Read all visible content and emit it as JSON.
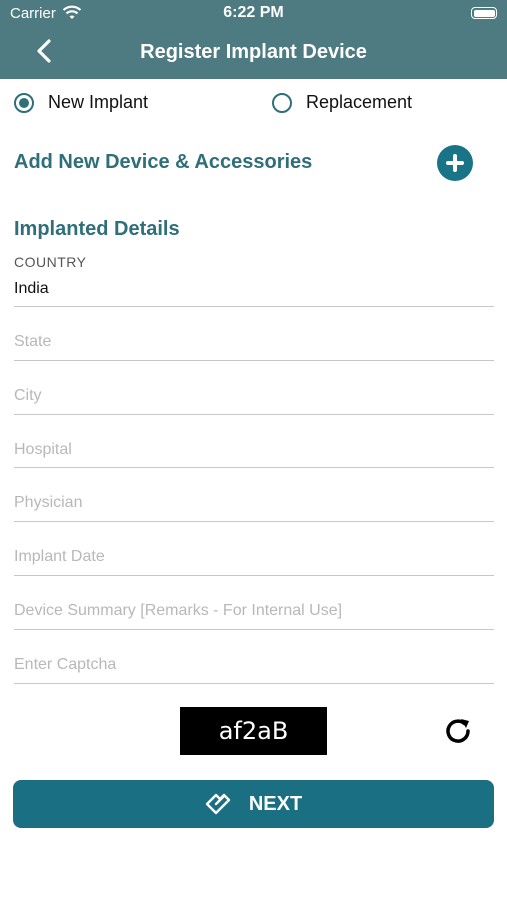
{
  "status_bar": {
    "carrier": "Carrier",
    "time": "6:22 PM"
  },
  "header": {
    "title": "Register Implant Device"
  },
  "radio": {
    "options": [
      {
        "label": "New Implant",
        "selected": true
      },
      {
        "label": "Replacement",
        "selected": false
      }
    ]
  },
  "add_device": {
    "label": "Add New Device & Accessories"
  },
  "implanted_details": {
    "heading": "Implanted Details",
    "country_label": "COUNTRY",
    "country_value": "India",
    "state_placeholder": "State",
    "city_placeholder": "City",
    "hospital_placeholder": "Hospital",
    "physician_placeholder": "Physician",
    "implant_date_placeholder": "Implant Date",
    "device_summary_placeholder": "Device Summary [Remarks - For Internal Use]",
    "captcha_placeholder": "Enter Captcha"
  },
  "captcha": {
    "text": "af2aB"
  },
  "next_button": {
    "label": "NEXT"
  },
  "colors": {
    "header": "#4e7a82",
    "accent": "#2f6f7a",
    "button": "#1a6f82"
  }
}
